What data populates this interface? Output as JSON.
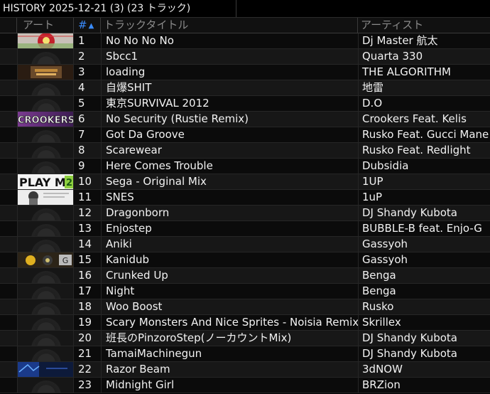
{
  "title": "HISTORY 2025-12-21 (3) (23 トラック)",
  "columns": {
    "art": "アート",
    "number": "#",
    "title": "トラックタイトル",
    "artist": "アーティスト"
  },
  "sort_icon": "sort-ascending-icon",
  "tracks": [
    {
      "n": "1",
      "title": "No No No No",
      "artist": "Dj Master 航太",
      "art": "pattern-red-green"
    },
    {
      "n": "2",
      "title": "Sbcc1",
      "artist": "Quarta 330",
      "art": "placeholder"
    },
    {
      "n": "3",
      "title": "loading",
      "artist": "THE ALGORITHM",
      "art": "dark-orange"
    },
    {
      "n": "4",
      "title": "自爆SHIT",
      "artist": "地雷",
      "art": "placeholder"
    },
    {
      "n": "5",
      "title": "東京SURVIVAL 2012",
      "artist": "D.O",
      "art": "placeholder"
    },
    {
      "n": "6",
      "title": "No Security (Rustie Remix)",
      "artist": "Crookers Feat. Kelis",
      "art": "crookers-purple"
    },
    {
      "n": "7",
      "title": "Got Da Groove",
      "artist": "Rusko Feat. Gucci Mane",
      "art": "placeholder"
    },
    {
      "n": "8",
      "title": "Scarewear",
      "artist": "Rusko Feat. Redlight",
      "art": "placeholder"
    },
    {
      "n": "9",
      "title": "Here Comes Trouble",
      "artist": "Dubsidia",
      "art": "placeholder"
    },
    {
      "n": "10",
      "title": "Sega - Original Mix",
      "artist": "1UP",
      "art": "play-me"
    },
    {
      "n": "11",
      "title": "SNES",
      "artist": "1uP",
      "art": "character-white"
    },
    {
      "n": "12",
      "title": "Dragonborn",
      "artist": "DJ Shandy Kubota",
      "art": "placeholder"
    },
    {
      "n": "13",
      "title": "Enjostep",
      "artist": "BUBBLE-B feat. Enjo-G",
      "art": "placeholder"
    },
    {
      "n": "14",
      "title": "Aniki",
      "artist": "Gassyoh",
      "art": "placeholder"
    },
    {
      "n": "15",
      "title": "Kanidub",
      "artist": "Gassyoh",
      "art": "gassyoh-yellow"
    },
    {
      "n": "16",
      "title": "Crunked Up",
      "artist": "Benga",
      "art": "placeholder"
    },
    {
      "n": "17",
      "title": "Night",
      "artist": "Benga",
      "art": "placeholder"
    },
    {
      "n": "18",
      "title": "Woo Boost",
      "artist": "Rusko",
      "art": "placeholder"
    },
    {
      "n": "19",
      "title": "Scary Monsters And Nice Sprites - Noisia Remix",
      "artist": "Skrillex",
      "art": "placeholder"
    },
    {
      "n": "20",
      "title": "班長のPinzoroStep(ノーカウントMix)",
      "artist": "DJ Shandy Kubota",
      "art": "placeholder"
    },
    {
      "n": "21",
      "title": "TamaiMachinegun",
      "artist": "DJ Shandy Kubota",
      "art": "placeholder"
    },
    {
      "n": "22",
      "title": "Razor Beam",
      "artist": "3dNOW",
      "art": "blue-dark"
    },
    {
      "n": "23",
      "title": "Midnight Girl",
      "artist": "BRZion",
      "art": "placeholder"
    }
  ]
}
